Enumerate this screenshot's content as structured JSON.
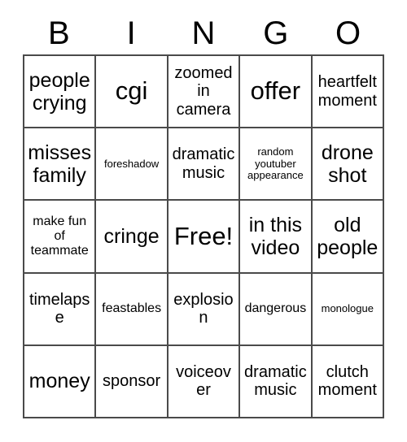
{
  "card": {
    "header_letters": [
      "B",
      "I",
      "N",
      "G",
      "O"
    ],
    "rows": [
      [
        {
          "text": "people crying",
          "size": "lg"
        },
        {
          "text": "cgi",
          "size": "xl"
        },
        {
          "text": "zoomed in camera",
          "size": "md"
        },
        {
          "text": "offer",
          "size": "xl"
        },
        {
          "text": "heartfelt moment",
          "size": "md"
        }
      ],
      [
        {
          "text": "misses family",
          "size": "lg"
        },
        {
          "text": "foreshadow",
          "size": "xs"
        },
        {
          "text": "dramatic music",
          "size": "md"
        },
        {
          "text": "random youtuber appearance",
          "size": "xs"
        },
        {
          "text": "drone shot",
          "size": "lg"
        }
      ],
      [
        {
          "text": "make fun of teammate",
          "size": "sm"
        },
        {
          "text": "cringe",
          "size": "lg"
        },
        {
          "text": "Free!",
          "size": "xl"
        },
        {
          "text": "in this video",
          "size": "lg"
        },
        {
          "text": "old people",
          "size": "lg"
        }
      ],
      [
        {
          "text": "timelapse",
          "size": "md"
        },
        {
          "text": "feastables",
          "size": "sm"
        },
        {
          "text": "explosion",
          "size": "md"
        },
        {
          "text": "dangerous",
          "size": "sm"
        },
        {
          "text": "monologue",
          "size": "xs"
        }
      ],
      [
        {
          "text": "money",
          "size": "lg"
        },
        {
          "text": "sponsor",
          "size": "md"
        },
        {
          "text": "voiceover",
          "size": "md"
        },
        {
          "text": "dramatic music",
          "size": "md"
        },
        {
          "text": "clutch moment",
          "size": "md"
        }
      ]
    ]
  },
  "colors": {
    "background": "#ffffff",
    "grid_line": "#4a4a4a",
    "text": "#000000"
  }
}
